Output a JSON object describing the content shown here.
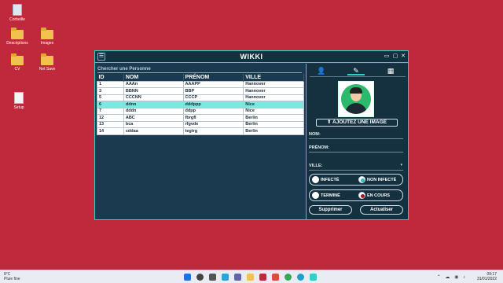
{
  "desktop": {
    "icons": [
      {
        "label": "Corbeille",
        "icon": "recycle-bin-icon"
      },
      {
        "label": "Descriptions",
        "icon": "folder-icon"
      },
      {
        "label": "Images",
        "icon": "folder-icon"
      },
      {
        "label": "CV",
        "icon": "folder-icon"
      },
      {
        "label": "Net Save",
        "icon": "folder-icon"
      },
      {
        "label": "Setup",
        "icon": "document-icon"
      }
    ]
  },
  "window": {
    "title": "WIKKI",
    "menu_icon": "☰",
    "minimize_icon": "▭",
    "maximize_icon": "▢",
    "close_icon": "✕",
    "accent": "#2fd0c8",
    "background": "#1c3a4f"
  },
  "search": {
    "label": "Chercher une Personne"
  },
  "table": {
    "columns": [
      "ID",
      "NOM",
      "PRÉNOM",
      "VILLE"
    ],
    "rows": [
      [
        "1",
        "AAAn",
        "AAAPP",
        "Hannover"
      ],
      [
        "3",
        "BBNN",
        "BBP",
        "Hannover"
      ],
      [
        "5",
        "CCCNN",
        "CCCP",
        "Hannover"
      ],
      [
        "6",
        "ddnn",
        "dddppp",
        "Nice"
      ],
      [
        "7",
        "dddn",
        "ddpp",
        "Nice"
      ],
      [
        "12",
        "ABC",
        "fbrgfl",
        "Berlin"
      ],
      [
        "13",
        "bca",
        "rfgvde",
        "Berlin"
      ],
      [
        "14",
        "cddaa",
        "tegtrg",
        "Berlin"
      ]
    ],
    "selected_row_index": 3,
    "selected_color": "#7de8e0"
  },
  "form": {
    "tabs": [
      {
        "name": "add-user-tab",
        "icon": "add-user-icon",
        "glyph": "👤"
      },
      {
        "name": "edit-user-tab",
        "icon": "edit-user-icon",
        "glyph": "✎"
      },
      {
        "name": "building-tab",
        "icon": "building-icon",
        "glyph": "▦"
      }
    ],
    "active_tab_index": 1,
    "add_image_label": "AJOUTEZ UNE IMAGE",
    "nom_label": "NOM:",
    "prenom_label": "PRÉNOM:",
    "ville_label": "VILLE:",
    "status_group_1": {
      "option_a": "INFECTÉ",
      "option_b": "NON INFECTÉ",
      "selected": "NON INFECTÉ"
    },
    "status_group_2": {
      "option_a": "TERMINÉ",
      "option_b": "EN COURS",
      "selected": "EN COURS"
    },
    "delete_label": "Supprimer",
    "refresh_label": "Actualiser"
  },
  "taskbar": {
    "weather_temp": "8°C",
    "weather_text": "Pluie fine",
    "time": "09:17",
    "date": "31/01/2022"
  }
}
